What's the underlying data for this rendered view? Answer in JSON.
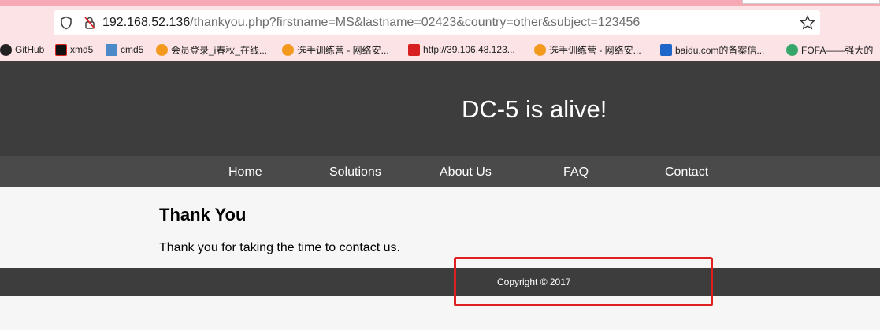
{
  "browser": {
    "url_host": "192.168.52.136",
    "url_path": "/thankyou.php?firstname=MS&lastname=02423&country=other&subject=123456",
    "bookmarks": [
      {
        "label": "GitHub",
        "icon": "github-icon"
      },
      {
        "label": "xmd5",
        "icon": "xmd5-icon"
      },
      {
        "label": "cmd5",
        "icon": "cmd5-icon"
      },
      {
        "label": "会员登录_i春秋_在线...",
        "icon": "ichunqiu-icon"
      },
      {
        "label": "选手训练营 - 网络安...",
        "icon": "ichunqiu-icon"
      },
      {
        "label": "http://39.106.48.123...",
        "icon": "z-icon"
      },
      {
        "label": "选手训练营 - 网络安...",
        "icon": "ichunqiu-icon"
      },
      {
        "label": "baidu.com的备案信...",
        "icon": "baidu-icon"
      },
      {
        "label": "FOFA——强大的",
        "icon": "fofa-icon"
      }
    ]
  },
  "site": {
    "title": "DC-5 is alive!",
    "nav": [
      "Home",
      "Solutions",
      "About Us",
      "FAQ",
      "Contact"
    ],
    "content_title": "Thank You",
    "content_text": "Thank you for taking the time to contact us.",
    "footer_text": "Copyright © 2017"
  },
  "colors": {
    "header_bg": "#3d3d3d",
    "nav_bg": "#4a4a4a",
    "highlight": "#e02020"
  }
}
